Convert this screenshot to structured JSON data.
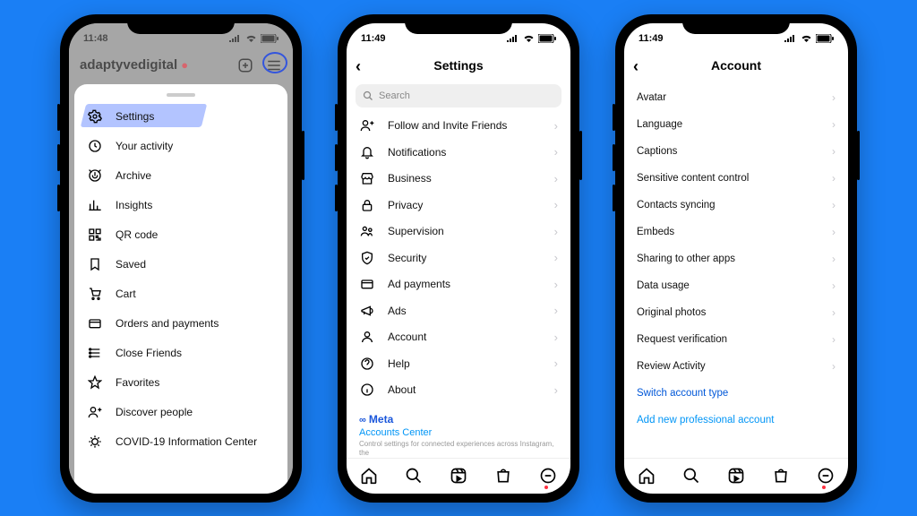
{
  "statusTime1": "11:48",
  "statusTime2": "11:49",
  "statusTime3": "11:49",
  "phone1": {
    "username": "adaptyvedigital",
    "menu": [
      {
        "icon": "gear",
        "label": "Settings",
        "hl": true
      },
      {
        "icon": "activity",
        "label": "Your activity"
      },
      {
        "icon": "archive",
        "label": "Archive"
      },
      {
        "icon": "insights",
        "label": "Insights"
      },
      {
        "icon": "qr",
        "label": "QR code"
      },
      {
        "icon": "saved",
        "label": "Saved"
      },
      {
        "icon": "cart",
        "label": "Cart"
      },
      {
        "icon": "orders",
        "label": "Orders and payments"
      },
      {
        "icon": "close",
        "label": "Close Friends"
      },
      {
        "icon": "star",
        "label": "Favorites"
      },
      {
        "icon": "discover",
        "label": "Discover people"
      },
      {
        "icon": "covid",
        "label": "COVID-19 Information Center"
      }
    ]
  },
  "phone2": {
    "title": "Settings",
    "searchPlaceholder": "Search",
    "rows": [
      {
        "icon": "follow",
        "label": "Follow and Invite Friends"
      },
      {
        "icon": "bell",
        "label": "Notifications"
      },
      {
        "icon": "biz",
        "label": "Business"
      },
      {
        "icon": "lock",
        "label": "Privacy"
      },
      {
        "icon": "sup",
        "label": "Supervision"
      },
      {
        "icon": "shield",
        "label": "Security"
      },
      {
        "icon": "card",
        "label": "Ad payments"
      },
      {
        "icon": "mega",
        "label": "Ads"
      },
      {
        "icon": "user",
        "label": "Account",
        "hl": true
      },
      {
        "icon": "help",
        "label": "Help"
      },
      {
        "icon": "info",
        "label": "About"
      }
    ],
    "metaLogo": "Meta",
    "metaLink": "Accounts Center",
    "metaDesc": "Control settings for connected experiences across Instagram, the"
  },
  "phone3": {
    "title": "Account",
    "rows": [
      "Avatar",
      "Language",
      "Captions",
      "Sensitive content control",
      "Contacts syncing",
      "Embeds",
      "Sharing to other apps",
      "Data usage",
      "Original photos",
      "Request verification",
      "Review Activity"
    ],
    "switchType": "Switch account type",
    "addPro": "Add new professional account"
  }
}
